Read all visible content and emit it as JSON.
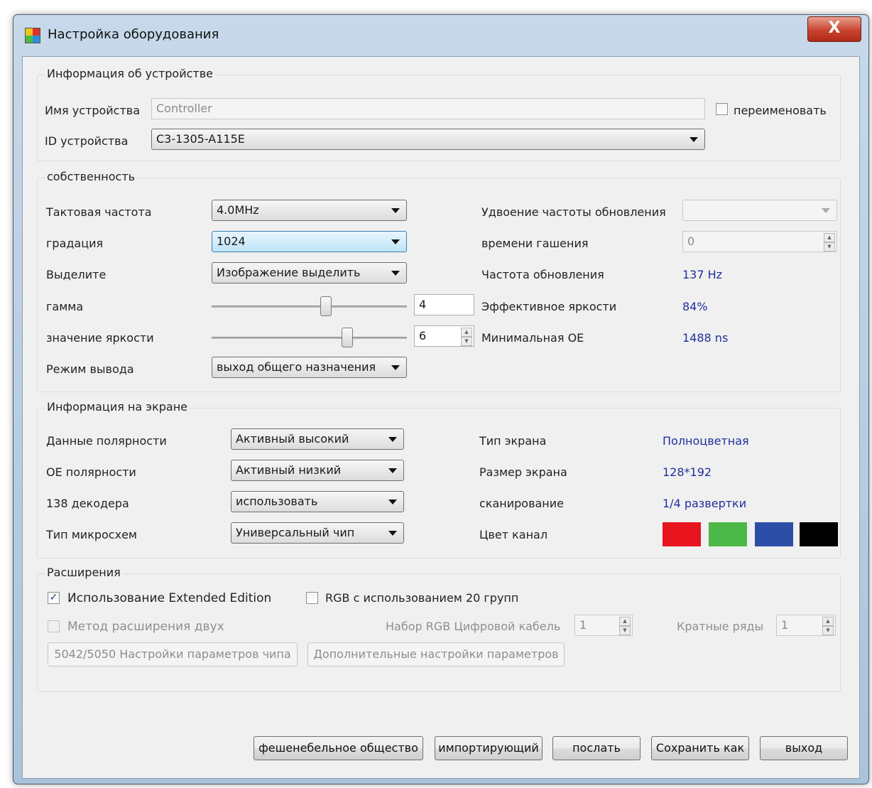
{
  "window": {
    "title": "Настройка оборудования",
    "close_label": "X"
  },
  "device_info": {
    "group_title": "Информация об устройстве",
    "name_label": "Имя устройства",
    "name_value": "Controller",
    "rename_label": "переименовать",
    "rename_checked": false,
    "id_label": "ID устройства",
    "id_value": "C3-1305-A115E"
  },
  "properties": {
    "group_title": "собственность",
    "clock_label": "Тактовая частота",
    "clock_value": "4.0MHz",
    "gradation_label": "градация",
    "gradation_value": "1024",
    "select_label": "Выделите",
    "select_value": "Изображение выделить",
    "gamma_label": "гамма",
    "gamma_value": "4",
    "brightness_label": "значение яркости",
    "brightness_value": "6",
    "output_mode_label": "Режим вывода",
    "output_mode_value": "выход общего назначения",
    "refresh_double_label": "Удвоение частоты обновления",
    "refresh_double_value": "",
    "blanking_label": "времени гашения",
    "blanking_value": "0",
    "refresh_rate_label": "Частота обновления",
    "refresh_rate_value": "137 Hz",
    "effective_brightness_label": "Эффективное яркости",
    "effective_brightness_value": "84%",
    "min_oe_label": "Минимальная ОЕ",
    "min_oe_value": "1488 ns"
  },
  "screen_info": {
    "group_title": "Информация на экране",
    "data_polarity_label": "Данные полярности",
    "data_polarity_value": "Активный высокий",
    "oe_polarity_label": "ОЕ полярности",
    "oe_polarity_value": "Активный низкий",
    "decoder_label": "138 декодера",
    "decoder_value": "использовать",
    "chip_type_label": "Тип микросхем",
    "chip_type_value": "Универсальный чип",
    "screen_type_label": "Тип экрана",
    "screen_type_value": "Полноцветная",
    "screen_size_label": "Размер экрана",
    "screen_size_value": "128*192",
    "scan_label": "сканирование",
    "scan_value": "1/4 развертки",
    "color_channel_label": "Цвет канал",
    "color_channels": [
      "#e8151f",
      "#4cb848",
      "#2c4ea6",
      "#000000"
    ]
  },
  "extensions": {
    "group_title": "Расширения",
    "extended_edition_label": "Использование Extended Edition",
    "extended_edition_checked": true,
    "rgb20_label": "RGB с использованием 20 групп",
    "rgb20_checked": false,
    "double_ext_label": "Метод расширения двух",
    "rgb_cable_label": "Набор RGB Цифровой кабель",
    "rgb_cable_value": "1",
    "multiple_rows_label": "Кратные ряды",
    "multiple_rows_value": "1",
    "chip_params_button": "5042/5050 Настройки параметров чипа",
    "extra_params_button": "Дополнительные настройки параметров"
  },
  "footer": {
    "fashion_button": "фешенебельное общество",
    "import_button": "импортирующий",
    "send_button": "послать",
    "save_as_button": "Сохранить как",
    "exit_button": "выход"
  }
}
